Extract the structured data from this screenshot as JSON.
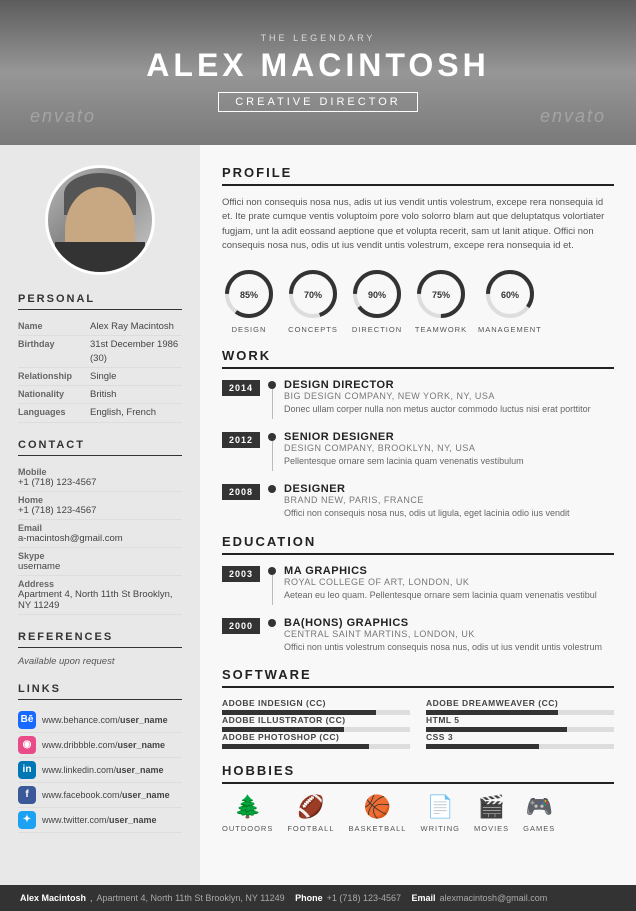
{
  "header": {
    "subtitle": "THE LEGENDARY",
    "name": "ALEX MACINTOSH",
    "title": "CREATIVE DIRECTOR",
    "watermark": "envato"
  },
  "left": {
    "personal_title": "PERSONAL",
    "personal": [
      {
        "label": "Name",
        "value": "Alex Ray Macintosh"
      },
      {
        "label": "Birthday",
        "value": "31st December 1986 (30)"
      },
      {
        "label": "Relationship",
        "value": "Single"
      },
      {
        "label": "Nationality",
        "value": "British"
      },
      {
        "label": "Languages",
        "value": "English, French"
      }
    ],
    "contact_title": "CONTACT",
    "contact": [
      {
        "label": "Mobile",
        "value": "+1 (718) 123-4567"
      },
      {
        "label": "Home",
        "value": "+1 (718) 123-4567"
      },
      {
        "label": "Email",
        "value": "a-macintosh@gmail.com"
      },
      {
        "label": "Skype",
        "value": "username"
      },
      {
        "label": "Address",
        "value": "Apartment 4, North 11th St Brooklyn, NY 11249"
      }
    ],
    "references_title": "REFERENCES",
    "references_text": "Available upon request",
    "links_title": "LINKS",
    "links": [
      {
        "type": "behance",
        "label": "Be",
        "prefix": "www.behance.com/",
        "username": "user_name"
      },
      {
        "type": "dribbble",
        "label": "Dr",
        "prefix": "www.dribbble.com/",
        "username": "user_name"
      },
      {
        "type": "linkedin",
        "label": "in",
        "prefix": "www.linkedin.com/",
        "username": "user_name"
      },
      {
        "type": "facebook",
        "label": "f",
        "prefix": "www.facebook.com/",
        "username": "user_name"
      },
      {
        "type": "twitter",
        "label": "t",
        "prefix": "www.twitter.com/",
        "username": "user_name"
      }
    ]
  },
  "right": {
    "profile_title": "PROFILE",
    "profile_text": "Offici non consequis nosa nus, adis ut ius vendit untis volestrum, excepe rera nonsequia id et. Ite prate cumque ventis voluptoim pore volo solorro blam aut que deluptatqus volortiater fugjam, unt la adit eossand aeptione que et volupta recerit, sam ut lanit atique. Offici non consequis nosa nus, odis ut ius vendit untis volestrum, excepe rera nonsequia id et.",
    "skills": [
      {
        "label": "DESIGN",
        "pct": 85
      },
      {
        "label": "CONCEPTS",
        "pct": 70
      },
      {
        "label": "DIRECTION",
        "pct": 90
      },
      {
        "label": "TEAMWORK",
        "pct": 75
      },
      {
        "label": "MANAGEMENT",
        "pct": 60
      }
    ],
    "work_title": "WORK",
    "work": [
      {
        "year": "2014",
        "title": "DESIGN DIRECTOR",
        "company": "BIG DESIGN COMPANY, NEW YORK, NY, USA",
        "desc": "Donec ullam corper nulla non metus auctor commodo luctus nisi erat porttitor"
      },
      {
        "year": "2012",
        "title": "SENIOR DESIGNER",
        "company": "DESIGN COMPANY, BROOKLYN, NY, USA",
        "desc": "Pellentesque ornare sem lacinia quam venenatis vestibulum"
      },
      {
        "year": "2008",
        "title": "DESIGNER",
        "company": "BRAND NEW, PARIS, FRANCE",
        "desc": "Offici non consequis nosa nus, odis ut ligula, eget lacinia odio ius vendit"
      }
    ],
    "education_title": "EDUCATION",
    "education": [
      {
        "year": "2003",
        "title": "MA GRAPHICS",
        "company": "ROYAL COLLEGE OF ART, LONDON, UK",
        "desc": "Aetean eu leo quam. Pellentesque ornare sem lacinia quam venenatis vestibul"
      },
      {
        "year": "2000",
        "title": "BA(HONS) GRAPHICS",
        "company": "CENTRAL SAINT MARTINS, LONDON, UK",
        "desc": "Offici non untis volestrum consequis nosa nus, odis ut ius vendit untis volestrum"
      }
    ],
    "software_title": "SOFTWARE",
    "software": [
      {
        "name": "ADOBE INDESIGN (CC)",
        "pct": 82,
        "col": 0
      },
      {
        "name": "ADOBE DREAMWEAVER (CC)",
        "pct": 70,
        "col": 1
      },
      {
        "name": "ADOBE ILLUSTRATOR (CC)",
        "pct": 65,
        "col": 0
      },
      {
        "name": "HTML 5",
        "pct": 75,
        "col": 1
      },
      {
        "name": "ADOBE PHOTOSHOP (CC)",
        "pct": 78,
        "col": 0
      },
      {
        "name": "CSS 3",
        "pct": 60,
        "col": 1
      }
    ],
    "hobbies_title": "HOBBIES",
    "hobbies": [
      {
        "label": "OUTDOORS",
        "icon": "🌲"
      },
      {
        "label": "FOOTBALL",
        "icon": "🏈"
      },
      {
        "label": "BASKETBALL",
        "icon": "🏀"
      },
      {
        "label": "WRITING",
        "icon": "📄"
      },
      {
        "label": "MOVIES",
        "icon": "🎬"
      },
      {
        "label": "GAMES",
        "icon": "🎮"
      }
    ]
  },
  "footer": {
    "name": "Alex Macintosh",
    "address": "Apartment 4, North 11th St Brooklyn, NY 11249",
    "phone_label": "Phone",
    "phone": "+1 (718) 123-4567",
    "email_label": "Email",
    "email": "alexmacintosh@gmail.com"
  }
}
